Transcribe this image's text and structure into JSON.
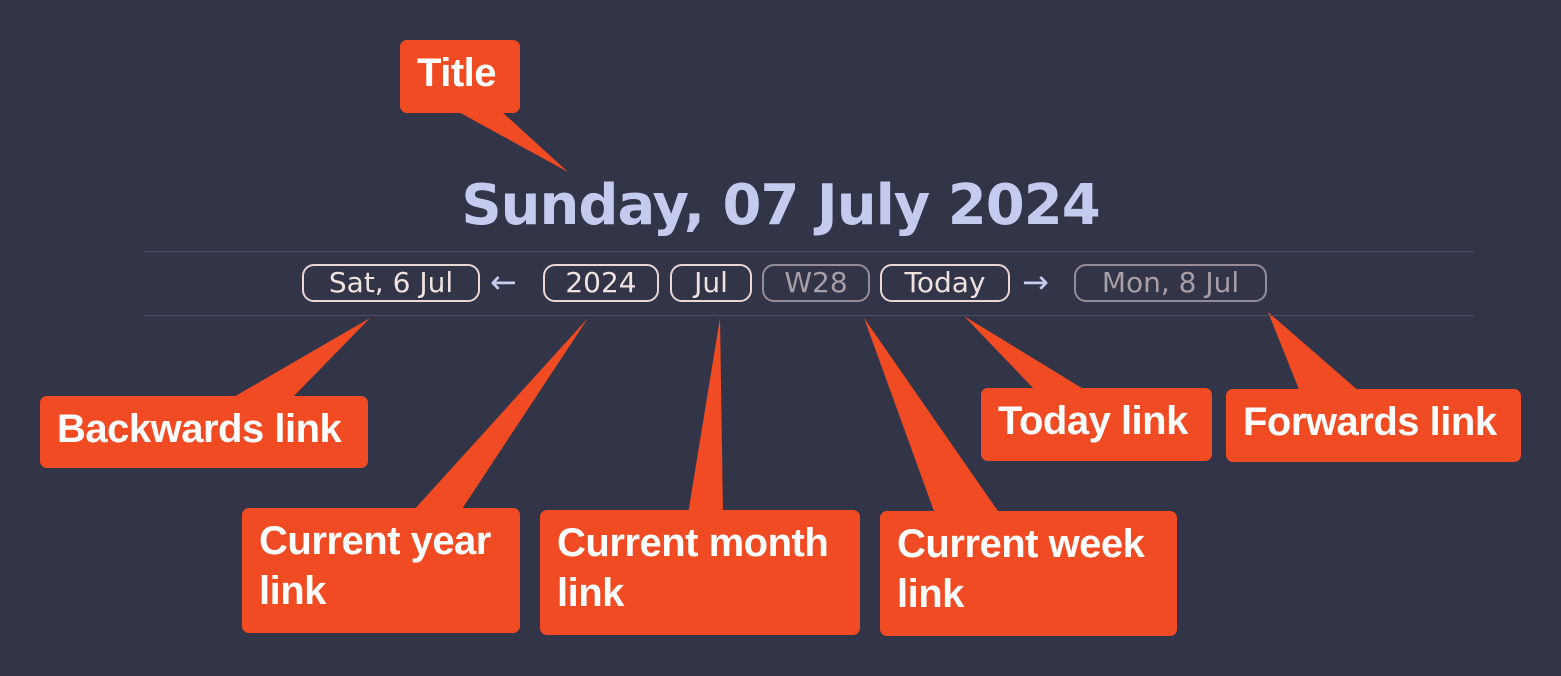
{
  "title": "Sunday, 07 July 2024",
  "nav": {
    "backwards_label": "Sat, 6 Jul",
    "back_arrow": "←",
    "year_label": "2024",
    "month_label": "Jul",
    "week_label": "W28",
    "today_label": "Today",
    "forward_arrow": "→",
    "forwards_label": "Mon, 8 Jul"
  },
  "annotations": {
    "title": "Title",
    "backwards": "Backwards link",
    "year": "Current year link",
    "month": "Current month link",
    "week": "Current week link",
    "today": "Today link",
    "forwards": "Forwards link"
  },
  "colors": {
    "background": "#323447",
    "title": "#c5cbee",
    "callout": "#f04b23",
    "pill_border": "#ead8d4",
    "pill_muted_border": "#958c95"
  }
}
